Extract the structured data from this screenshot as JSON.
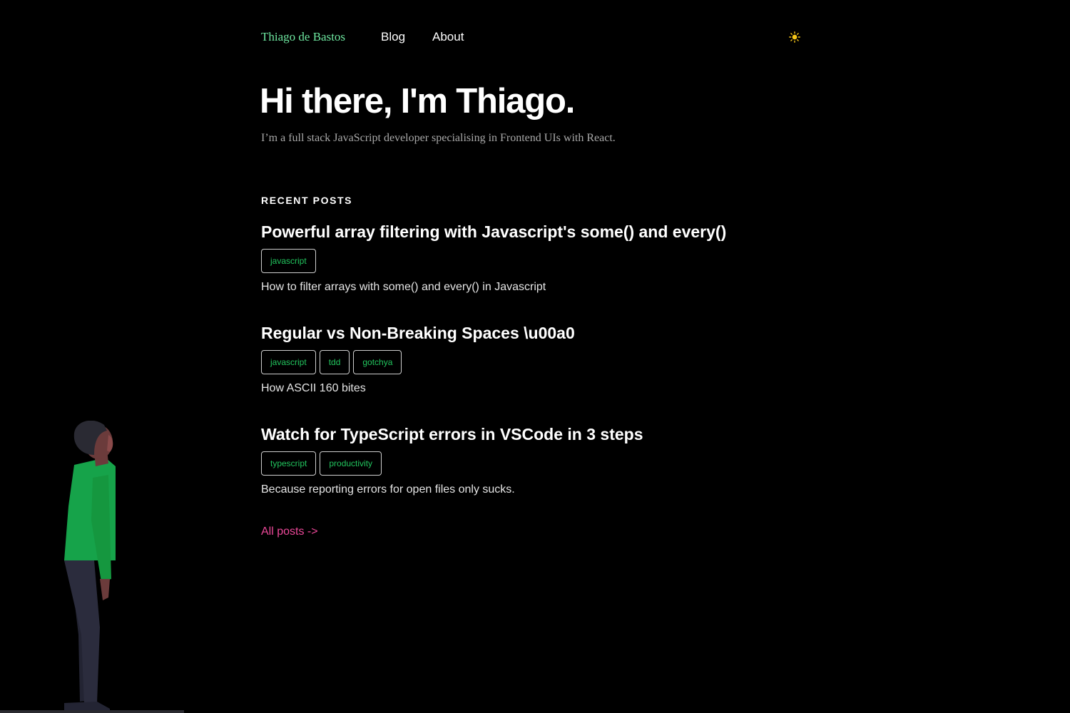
{
  "nav": {
    "brand": "Thiago de Bastos",
    "links": [
      {
        "label": "Blog"
      },
      {
        "label": "About"
      }
    ],
    "theme_toggle_icon": "sun-icon"
  },
  "hero": {
    "title": "Hi there, I'm Thiago.",
    "subtitle": "I’m a full stack JavaScript developer specialising in Frontend UIs with React."
  },
  "recent_posts": {
    "heading": "RECENT POSTS",
    "posts": [
      {
        "title": "Powerful array filtering with Javascript's some() and every()",
        "tags": [
          "javascript"
        ],
        "description": "How to filter arrays with some() and every() in Javascript"
      },
      {
        "title": "Regular vs Non-Breaking Spaces \\u00a0",
        "tags": [
          "javascript",
          "tdd",
          "gotchya"
        ],
        "description": "How ASCII 160 bites"
      },
      {
        "title": "Watch for TypeScript errors in VSCode in 3 steps",
        "tags": [
          "typescript",
          "productivity"
        ],
        "description": "Because reporting errors for open files only sucks."
      }
    ],
    "all_posts_label": "All posts ->"
  },
  "colors": {
    "background": "#000000",
    "brand": "#6ee7a0",
    "tag_text": "#22c55e",
    "link_accent": "#ec4899",
    "sun": "#f5c518"
  },
  "illustration": "person-looking-up-illustration"
}
